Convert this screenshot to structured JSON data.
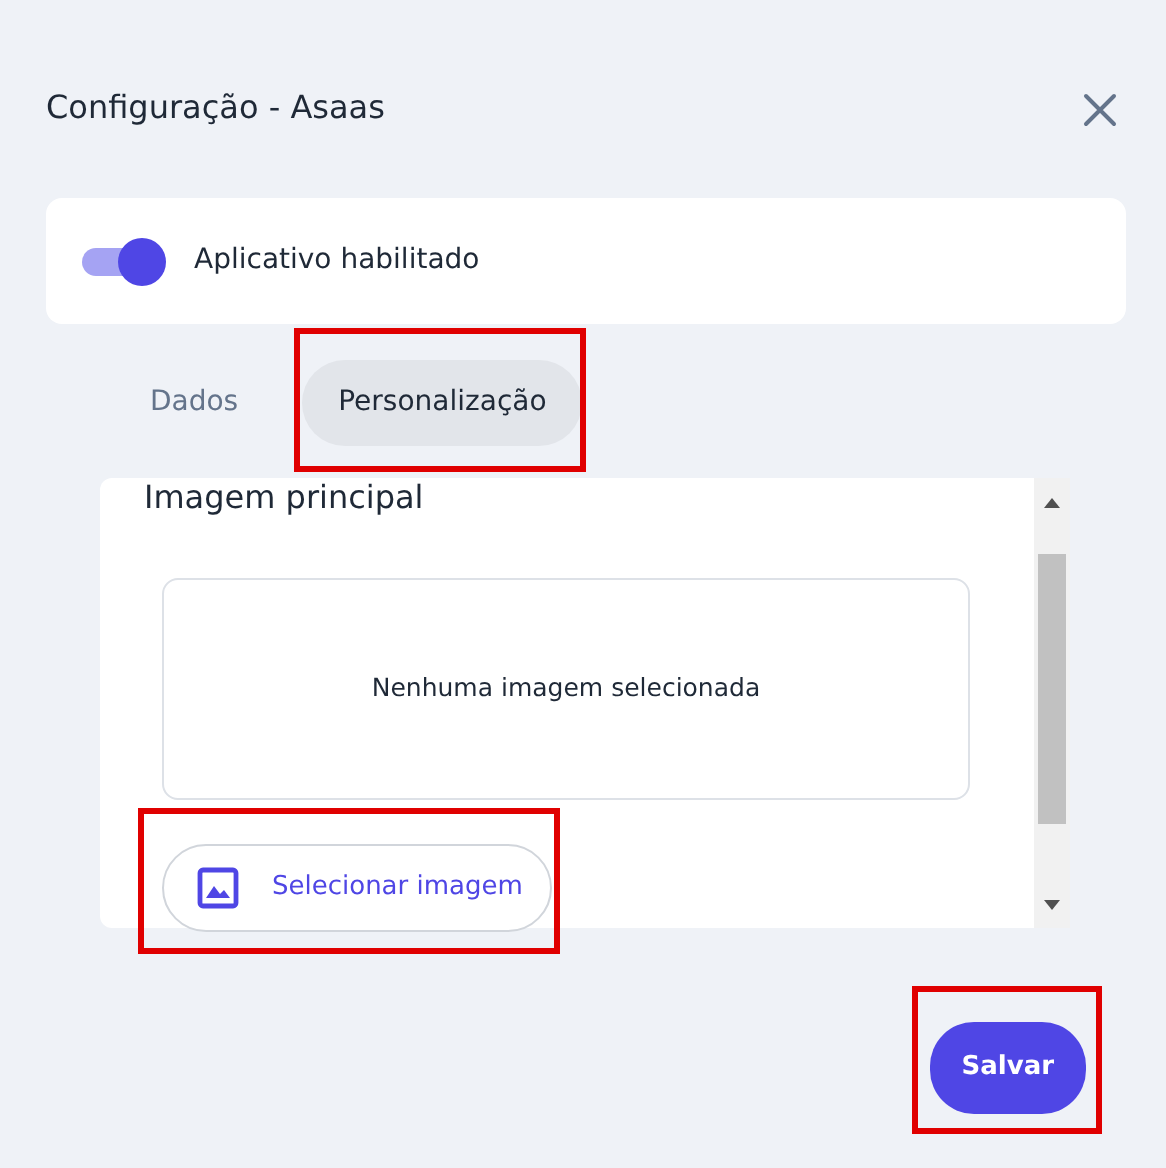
{
  "window": {
    "title": "Configuração - Asaas"
  },
  "app_toggle": {
    "label": "Aplicativo habilitado",
    "on": true
  },
  "tabs": [
    {
      "label": "Dados",
      "selected": false,
      "highlighted": false
    },
    {
      "label": "Personalização",
      "selected": true,
      "highlighted": true
    }
  ],
  "section": {
    "title": "Imagem principal",
    "image_box": {
      "text": "Nenhuma imagem selecionada"
    },
    "select_button": {
      "label": "Selecionar imagem",
      "highlighted": true
    }
  },
  "save_button": {
    "label": "Salvar",
    "highlighted": true
  }
}
